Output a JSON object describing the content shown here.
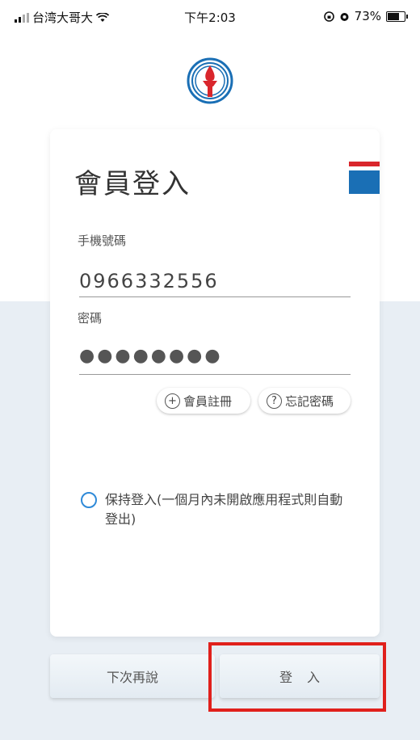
{
  "status_bar": {
    "carrier": "台湾大哥大",
    "time": "下午2:03",
    "battery": "73%"
  },
  "card": {
    "title": "會員登入",
    "phone_label": "手機號碼",
    "phone_value": "0966332556",
    "password_label": "密碼",
    "password_value": "●●●●●●●●",
    "register_label": "會員註冊",
    "forgot_label": "忘記密碼",
    "keep_login_label": "保持登入(一個月內未開啟應用程式則自動登出)"
  },
  "buttons": {
    "later_label": "下次再說",
    "login_label": "登入"
  },
  "colors": {
    "accent": "#2f8ad8",
    "highlight": "#e0201c",
    "flag_red": "#d9262c",
    "flag_blue": "#1a6fb5"
  }
}
